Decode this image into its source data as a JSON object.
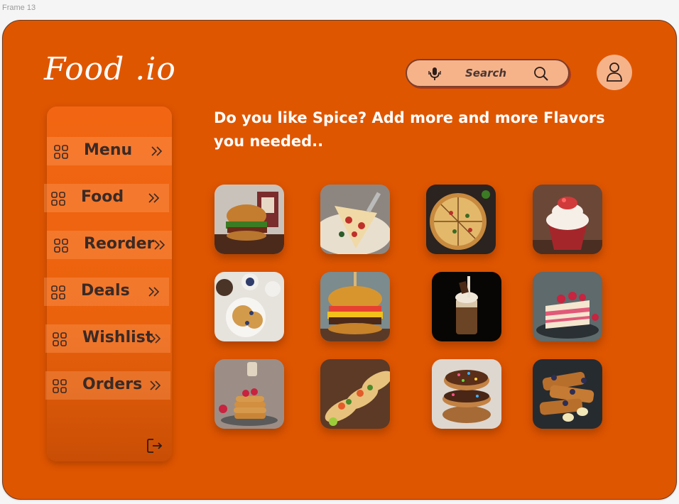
{
  "frame_label": "Frame 13",
  "brand": {
    "logo": "Food .io"
  },
  "search": {
    "label": "Search",
    "mic_icon": "mic-icon",
    "icon": "search-icon"
  },
  "profile": {
    "icon": "user-icon"
  },
  "headline": "Do you like Spice? Add more and more Flavors you needed..",
  "sidebar": {
    "items": [
      {
        "label": "Menu"
      },
      {
        "label": "Food"
      },
      {
        "label": "Reorder"
      },
      {
        "label": "Deals"
      },
      {
        "label": "Wishlist"
      },
      {
        "label": "Orders"
      }
    ],
    "logout_icon": "logout-icon"
  },
  "gallery": [
    {
      "name": "burger"
    },
    {
      "name": "pizza-slice"
    },
    {
      "name": "pizza"
    },
    {
      "name": "cupcake"
    },
    {
      "name": "waffles"
    },
    {
      "name": "cheeseburger"
    },
    {
      "name": "milkshake"
    },
    {
      "name": "cake-slice"
    },
    {
      "name": "pancakes"
    },
    {
      "name": "tacos"
    },
    {
      "name": "donuts"
    },
    {
      "name": "french-toast"
    }
  ],
  "colors": {
    "background": "#df5600",
    "sidebar": "#f26613",
    "search_bg": "#f6b38a",
    "text_dark": "#3a2a25"
  }
}
